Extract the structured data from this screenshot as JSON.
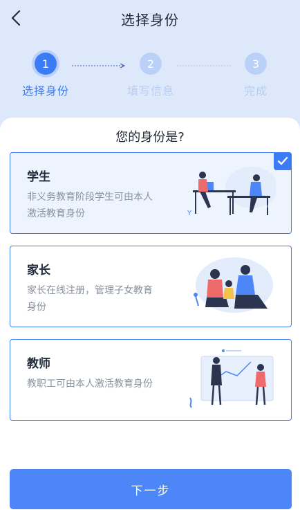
{
  "header": {
    "title": "选择身份",
    "back_icon": "chevron-left-icon"
  },
  "stepper": {
    "steps": [
      {
        "number": "1",
        "label": "选择身份",
        "state": "active"
      },
      {
        "number": "2",
        "label": "填写信息",
        "state": "inactive"
      },
      {
        "number": "3",
        "label": "完成",
        "state": "inactive"
      }
    ]
  },
  "main": {
    "question": "您的身份是?",
    "roles": [
      {
        "title": "学生",
        "description": "非义务教育阶段学生可由本人激活教育身份",
        "selected": true
      },
      {
        "title": "家长",
        "description": "家长在线注册，管理子女教育身份",
        "selected": false
      },
      {
        "title": "教师",
        "description": "教职工可由本人激活教育身份",
        "selected": false
      }
    ]
  },
  "footer": {
    "next_label": "下一步"
  },
  "colors": {
    "accent": "#3b7cf5",
    "header_bg": "#dde9fb",
    "inactive_step": "#bad0f6"
  }
}
